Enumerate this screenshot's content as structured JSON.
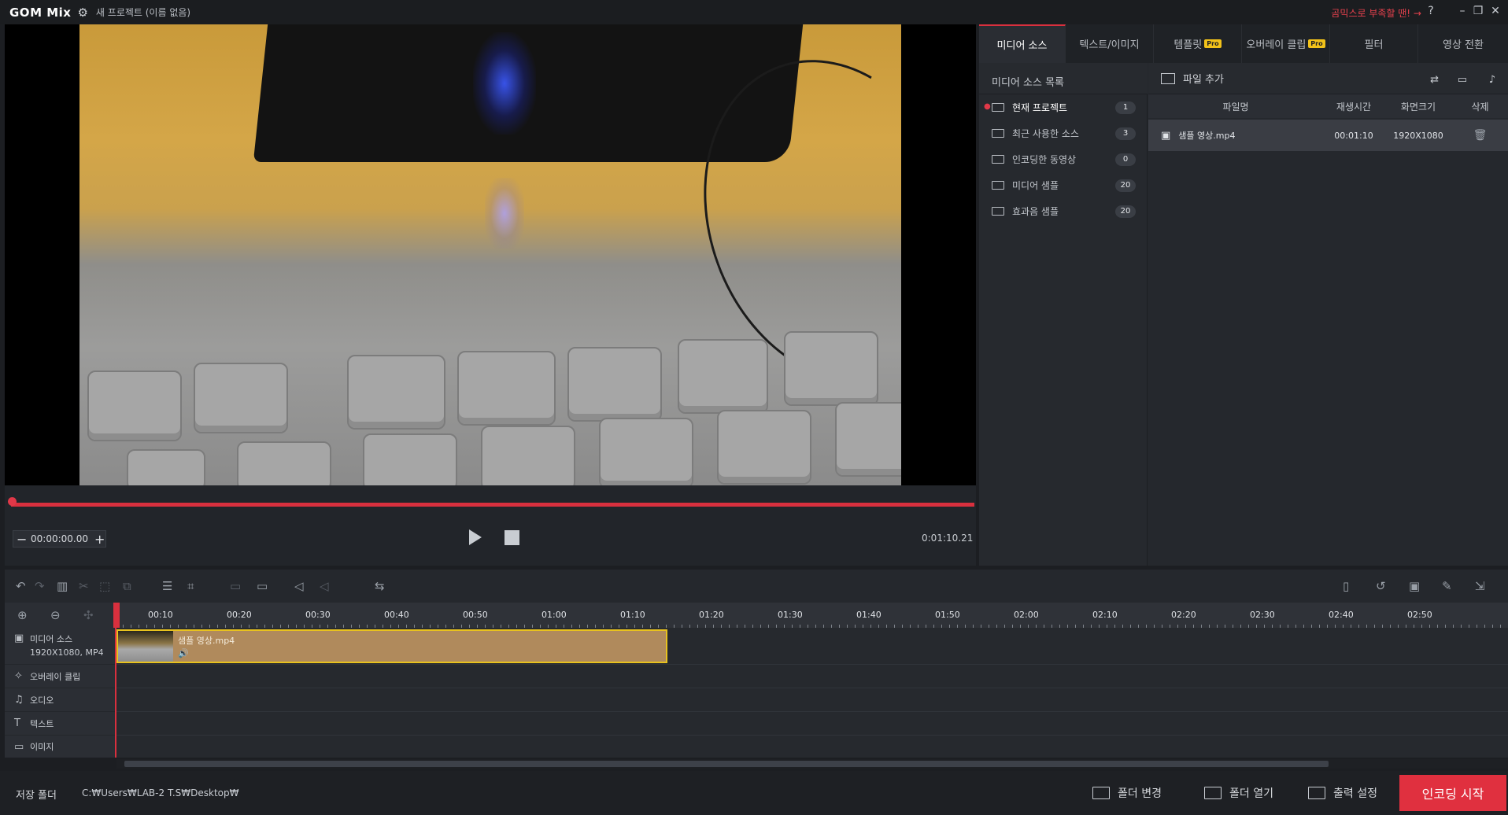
{
  "titlebar": {
    "logo": "GOM Mix",
    "project_title": "새 프로젝트 (이름 없음)",
    "promo": "곰믹스로 부족할 땐! →",
    "help": "?",
    "minimize": "–",
    "restore": "❐",
    "close": "✕"
  },
  "preview": {
    "current_time": "00:00:00.00",
    "total_time": "0:01:10.21",
    "minus": "−",
    "plus": "+",
    "progress": 0.0
  },
  "tabs": [
    {
      "label": "미디어 소스",
      "pro": ""
    },
    {
      "label": "텍스트/이미지",
      "pro": ""
    },
    {
      "label": "템플릿",
      "pro": "Pro"
    },
    {
      "label": "오버레이 클립",
      "pro": "Pro"
    },
    {
      "label": "필터",
      "pro": ""
    },
    {
      "label": "영상 전환",
      "pro": ""
    }
  ],
  "source_list": {
    "header": "미디어 소스 목록",
    "items": [
      {
        "label": "현재 프로젝트",
        "count": "1"
      },
      {
        "label": "최근 사용한 소스",
        "count": "3"
      },
      {
        "label": "인코딩한 동영상",
        "count": "0"
      },
      {
        "label": "미디어 샘플",
        "count": "20"
      },
      {
        "label": "효과음 샘플",
        "count": "20"
      }
    ]
  },
  "file_panel": {
    "add_file": "파일 추가",
    "columns": [
      "파일명",
      "재생시간",
      "화면크기",
      "삭제"
    ],
    "rows": [
      {
        "name": "샘플 영상.mp4",
        "duration": "00:01:10",
        "size": "1920X1080"
      }
    ]
  },
  "ruler": {
    "labels": [
      "00:10",
      "00:20",
      "00:30",
      "00:40",
      "00:50",
      "01:00",
      "01:10",
      "01:20",
      "01:30",
      "01:40",
      "01:50",
      "02:00",
      "02:10",
      "02:20",
      "02:30",
      "02:40",
      "02:50"
    ]
  },
  "tracks": {
    "media_label": "미디어 소스",
    "media_sub": "1920X1080, MP4",
    "overlay_label": "오버레이 클립",
    "audio_label": "오디오",
    "text_label": "텍스트",
    "image_label": "이미지"
  },
  "clip": {
    "name": "샘플 영상.mp4",
    "audio_icon": "🔊"
  },
  "statusbar": {
    "save_folder_label": "저장 폴더",
    "save_path": "C:₩Users₩LAB-2 T.S₩Desktop₩",
    "change_folder": "폴더 변경",
    "open_folder": "폴더 열기",
    "output_settings": "출력 설정",
    "start_encoding": "인코딩 시작"
  },
  "colors": {
    "accent": "#e0303f",
    "pro_badge": "#f2c21a",
    "clip_border": "#e8c21e"
  }
}
